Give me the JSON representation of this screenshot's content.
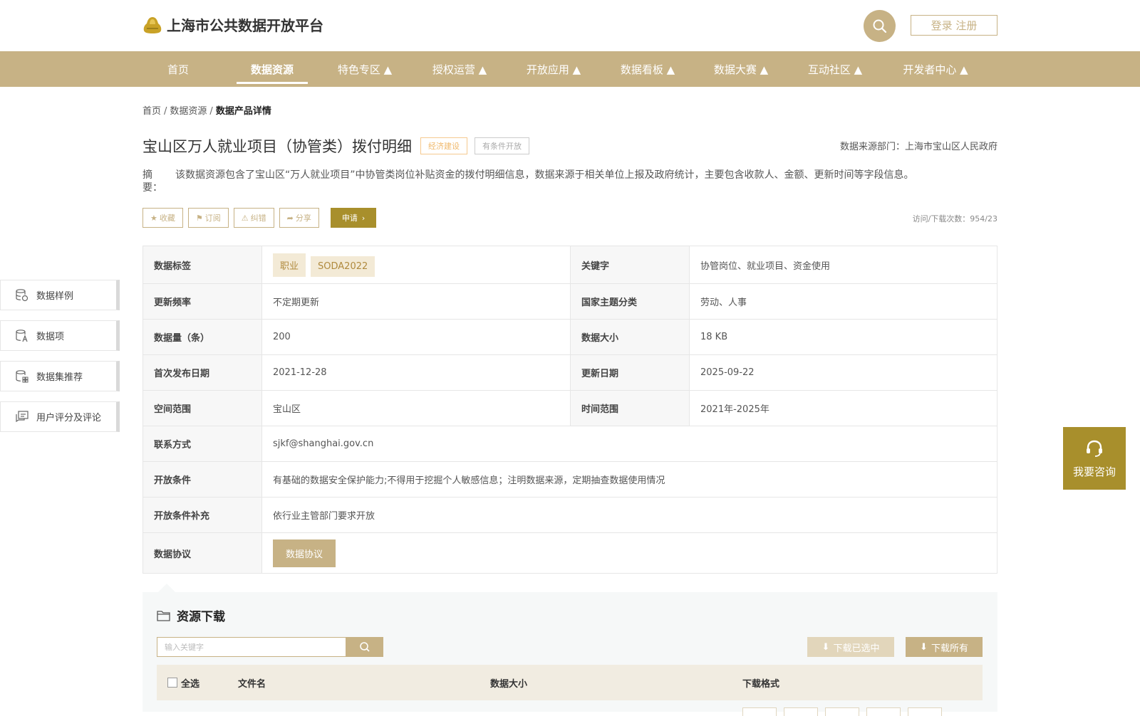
{
  "header": {
    "site_title": "上海市公共数据开放平台",
    "login_label": "登录 注册"
  },
  "nav": {
    "items": [
      {
        "label": "首页"
      },
      {
        "label": "数据资源"
      },
      {
        "label": "特色专区 ▲"
      },
      {
        "label": "授权运营 ▲"
      },
      {
        "label": "开放应用 ▲"
      },
      {
        "label": "数据看板 ▲"
      },
      {
        "label": "数据大赛 ▲"
      },
      {
        "label": "互动社区 ▲"
      },
      {
        "label": "开发者中心 ▲"
      }
    ]
  },
  "breadcrumb": {
    "home": "首页",
    "sep": "/",
    "level2": "数据资源",
    "current": "数据产品详情"
  },
  "product": {
    "title": "宝山区万人就业项目（协管类）拨付明细",
    "tag_category": "经济建设",
    "tag_open": "有条件开放",
    "source_dept": "数据来源部门：上海市宝山区人民政府",
    "abstract_label": "摘　要：",
    "abstract_text": "该数据资源包含了宝山区“万人就业项目”中协管类岗位补贴资金的拨付明细信息，数据来源于相关单位上报及政府统计，主要包含收款人、金额、更新时间等字段信息。",
    "visit_count": "访问/下载次数：954/23"
  },
  "actions": {
    "favorite": "收藏",
    "subscribe": "订阅",
    "correct": "纠错",
    "share": "分享",
    "apply": "申请"
  },
  "info": {
    "tags_label": "数据标签",
    "tags": [
      "职业",
      "SODA2022"
    ],
    "keywords_label": "关键字",
    "keywords": "协管岗位、就业项目、资金使用",
    "freq_label": "更新频率",
    "freq": "不定期更新",
    "theme_label": "国家主题分类",
    "theme": "劳动、人事",
    "count_label": "数据量（条）",
    "count": "200",
    "size_label": "数据大小",
    "size": "18 KB",
    "first_date_label": "首次发布日期",
    "first_date": "2021-12-28",
    "update_date_label": "更新日期",
    "update_date": "2025-09-22",
    "space_label": "空间范围",
    "space": "宝山区",
    "time_label": "时间范围",
    "time": "2021年-2025年",
    "contact_label": "联系方式",
    "contact": "sjkf@shanghai.gov.cn",
    "cond_label": "开放条件",
    "cond": "有基础的数据安全保护能力;不得用于挖掘个人敏感信息；注明数据来源，定期抽查数据使用情况",
    "cond_extra_label": "开放条件补充",
    "cond_extra": "依行业主管部门要求开放",
    "agreement_label": "数据协议",
    "agreement_btn": "数据协议"
  },
  "sidebar": {
    "items": [
      {
        "label": "数据样例"
      },
      {
        "label": "数据项"
      },
      {
        "label": "数据集推荐"
      },
      {
        "label": "用户评分及评论"
      }
    ]
  },
  "consult": {
    "label": "我要咨询"
  },
  "resources": {
    "title": "资源下载",
    "search_placeholder": "输入关键字",
    "download_selected": "下载已选中",
    "download_all": "下载所有",
    "columns": {
      "select_all": "全选",
      "filename": "文件名",
      "size": "数据大小",
      "format": "下载格式"
    }
  },
  "colors": {
    "brand": "#c7b285",
    "accent": "#a88f2c"
  }
}
